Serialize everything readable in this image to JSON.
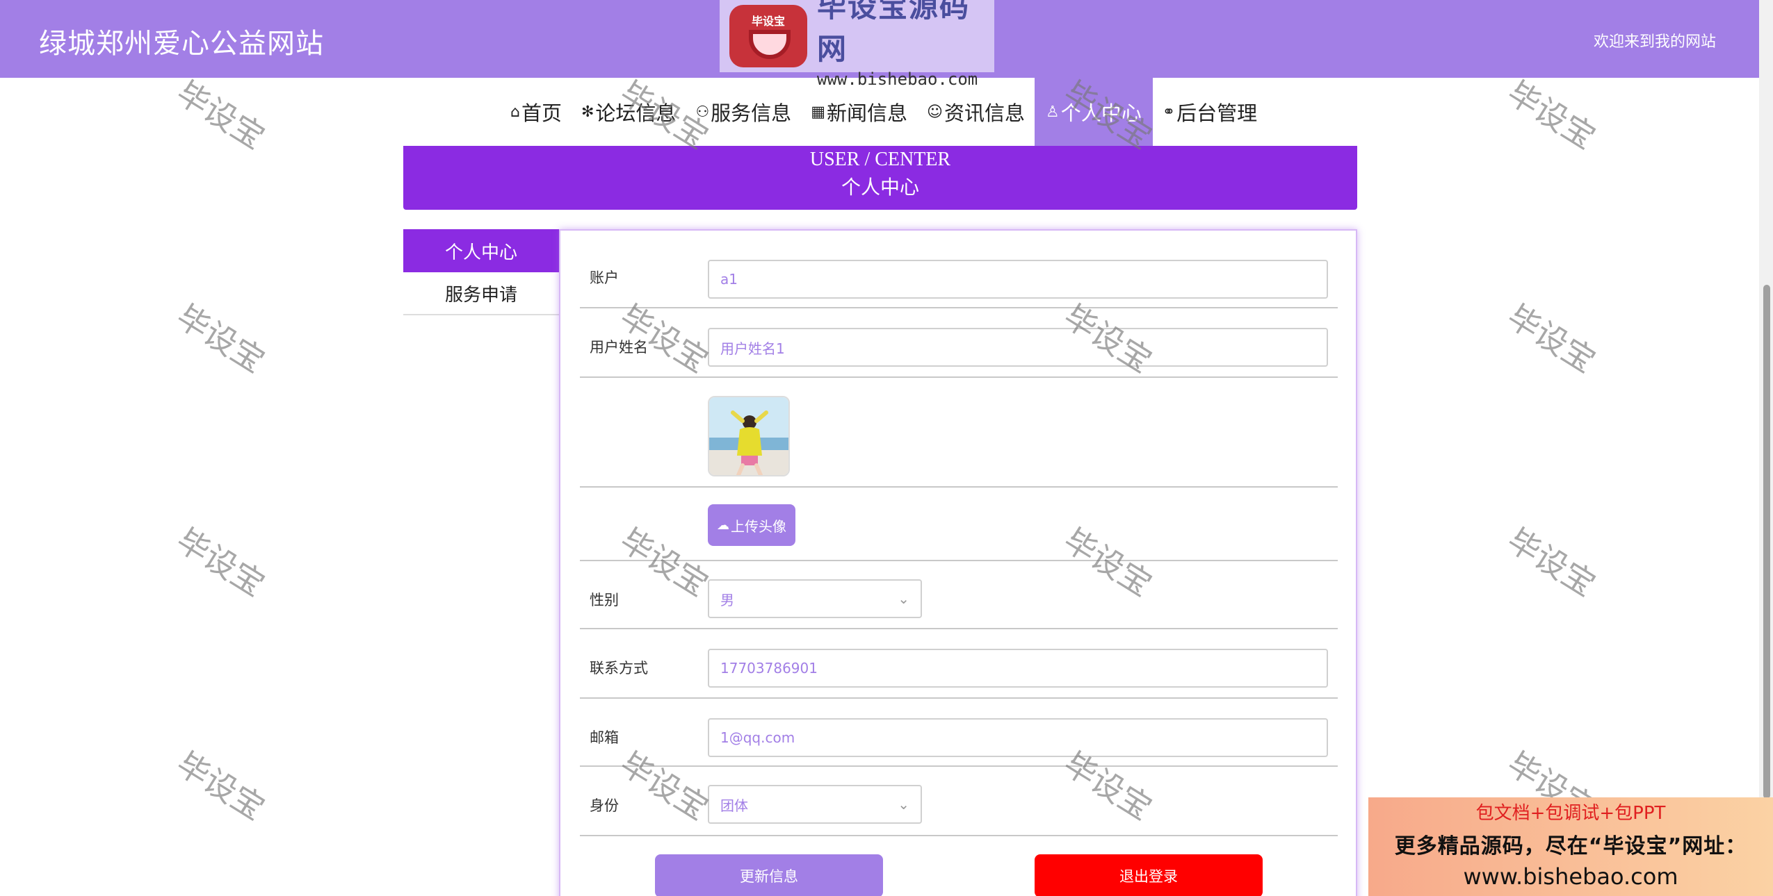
{
  "header": {
    "site_title": "绿城郑州爱心公益网站",
    "logo_badge": "毕设宝",
    "logo_main": "毕设宝源码网",
    "logo_sub": "www.bishebao.com",
    "welcome": "欢迎来到我的网站"
  },
  "nav": {
    "items": [
      {
        "icon": "⌂",
        "label": "首页"
      },
      {
        "icon": "✻",
        "label": "论坛信息"
      },
      {
        "icon": "⚇",
        "label": "服务信息"
      },
      {
        "icon": "▦",
        "label": "新闻信息"
      },
      {
        "icon": "☺",
        "label": "资讯信息"
      },
      {
        "icon": "♙",
        "label": "个人中心"
      },
      {
        "icon": "⚭",
        "label": "后台管理"
      }
    ],
    "active": "个人中心"
  },
  "banner": {
    "en": "USER / CENTER",
    "cn": "个人中心"
  },
  "side_menu": {
    "items": [
      "个人中心",
      "服务申请"
    ]
  },
  "form": {
    "account_label": "账户",
    "account_value": "a1",
    "name_label": "用户姓名",
    "name_value": "用户姓名1",
    "upload_label": "上传头像",
    "gender_label": "性别",
    "gender_value": "男",
    "phone_label": "联系方式",
    "phone_value": "17703786901",
    "email_label": "邮箱",
    "email_value": "1@qq.com",
    "identity_label": "身份",
    "identity_value": "团体",
    "update_button": "更新信息",
    "logout_button": "退出登录"
  },
  "watermark": "毕设宝",
  "ad": {
    "line1": "包文档+包调试+包PPT",
    "line2": "更多精品源码，尽在“毕设宝”网址：",
    "line3": "www.bishebao.com"
  },
  "colors": {
    "header": "#a27fe6",
    "banner": "#8b2be2",
    "logout": "#ff0000"
  }
}
